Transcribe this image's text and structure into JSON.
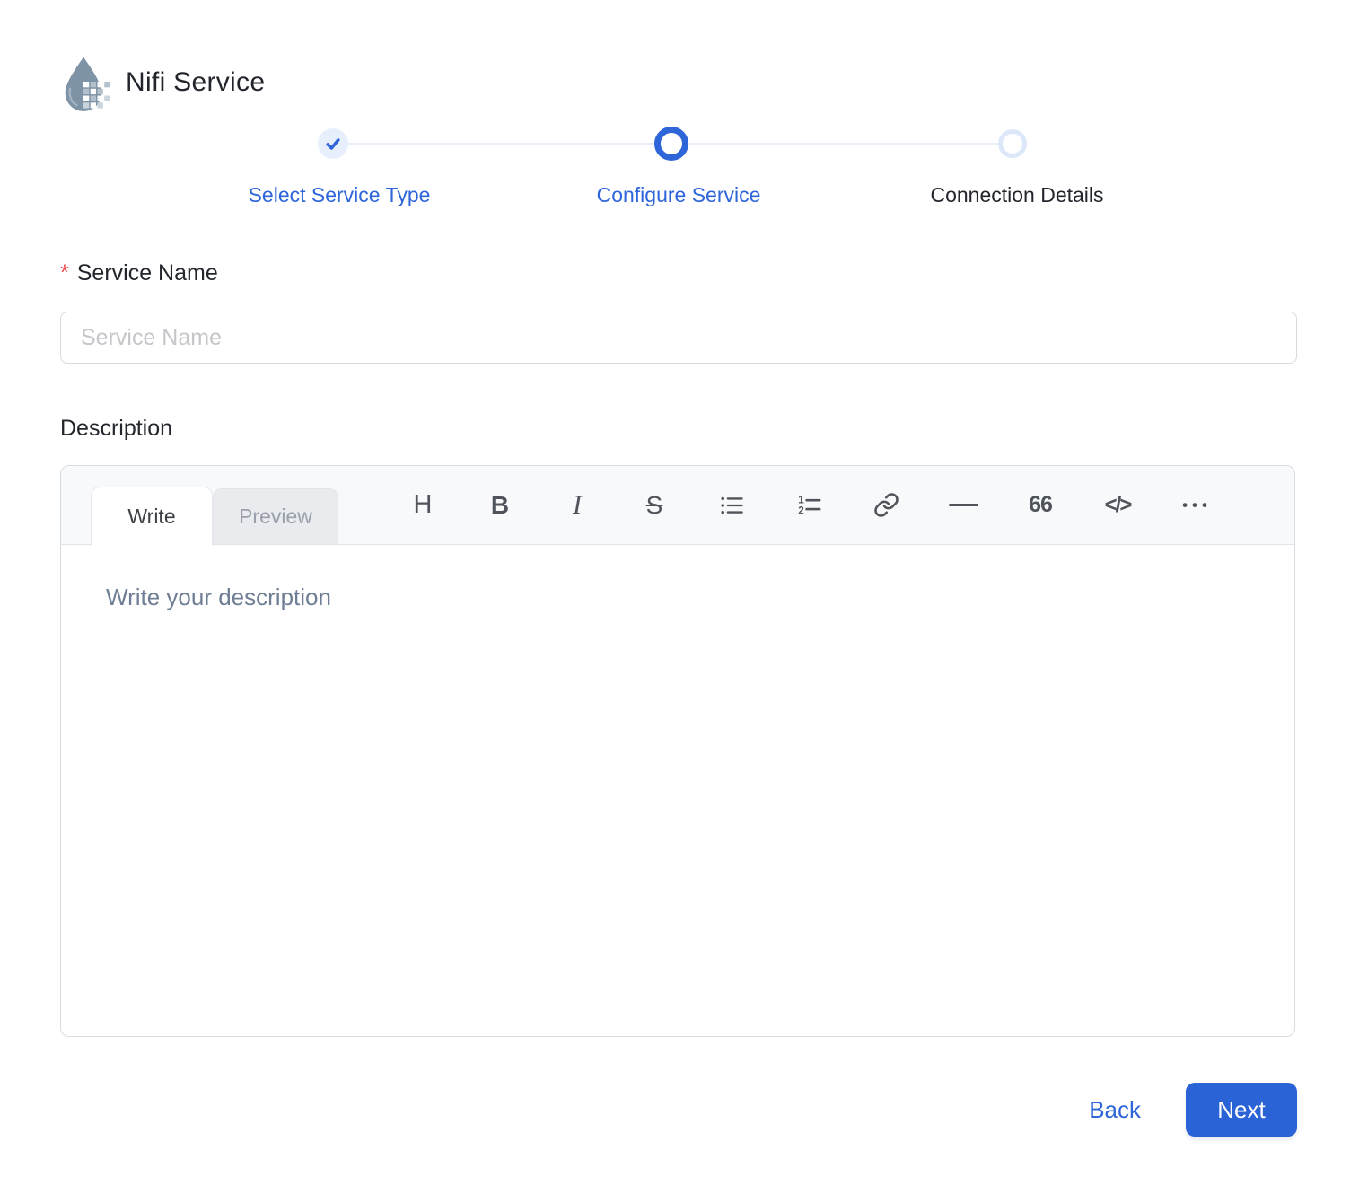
{
  "header": {
    "title": "Nifi Service",
    "logo_icon": "nifi-drop-icon"
  },
  "stepper": {
    "steps": [
      {
        "label": "Select Service Type",
        "state": "completed",
        "icon": "check-icon"
      },
      {
        "label": "Configure Service",
        "state": "active",
        "icon": "ring-icon"
      },
      {
        "label": "Connection Details",
        "state": "upcoming",
        "icon": "ring-icon"
      }
    ]
  },
  "form": {
    "service_name": {
      "required_marker": "*",
      "label": "Service Name",
      "placeholder": "Service Name",
      "value": ""
    },
    "description": {
      "label": "Description",
      "editor": {
        "tabs": {
          "write": "Write",
          "preview": "Preview"
        },
        "active_tab": "Write",
        "toolbar": {
          "heading": "H",
          "bold": "B",
          "italic": "I",
          "strikethrough": "S",
          "bulleted_list": "bulleted-list-icon",
          "numbered_list": "numbered-list-icon",
          "link": "link-icon",
          "horizontal_rule": "horizontal-rule-icon",
          "quote": "66",
          "code": "</>",
          "more": "•••"
        },
        "placeholder": "Write your description",
        "value": ""
      }
    }
  },
  "actions": {
    "back": "Back",
    "next": "Next"
  },
  "colors": {
    "accent": "#2e65d9",
    "next_button": "#2a63d6",
    "step_done_bg": "#e7effc",
    "step_upcoming_ring": "#dce8f9",
    "step_line": "#e9eff9",
    "logo": "#7e93a6",
    "required": "#f5474a",
    "toolbar_bg": "#f8f9fb"
  }
}
